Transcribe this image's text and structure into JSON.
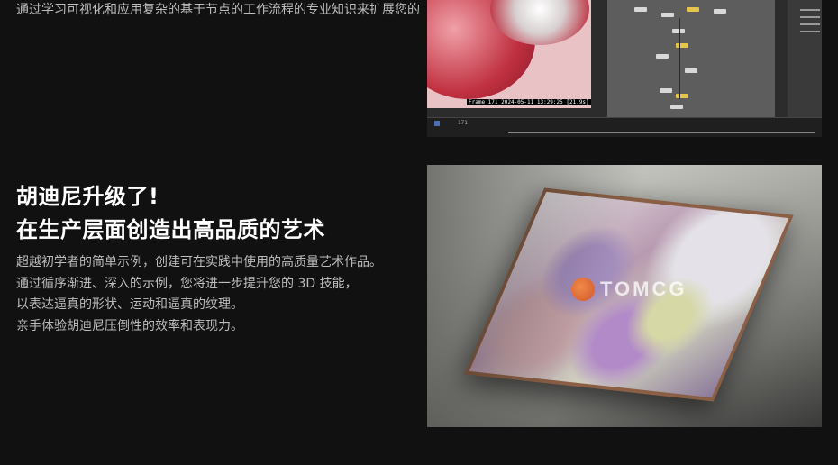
{
  "intro": {
    "text": "通过学习可视化和应用复杂的基于节点的工作流程的专业知识来扩展您的"
  },
  "screenshot": {
    "frame_status": "Frame 171  2024-05-11 13:29:25  [21.9s]",
    "frame_counter": "171"
  },
  "section": {
    "title_line1": "胡迪尼升级了!",
    "title_line2": "在生产层面创造出高品质的艺术",
    "description": [
      "超越初学者的简单示例，创建可在实践中使用的高质量艺术作品。",
      "通过循序渐进、深入的示例，您将进一步提升您的 3D 技能，",
      "以表达逼真的形状、运动和逼真的纹理。",
      "亲手体验胡迪尼压倒性的效率和表现力。"
    ]
  },
  "artwork": {
    "watermark": "TOMCG"
  },
  "colors": {
    "background": "#111111",
    "heading": "#ffffff",
    "body_text": "#bdbdbd"
  }
}
